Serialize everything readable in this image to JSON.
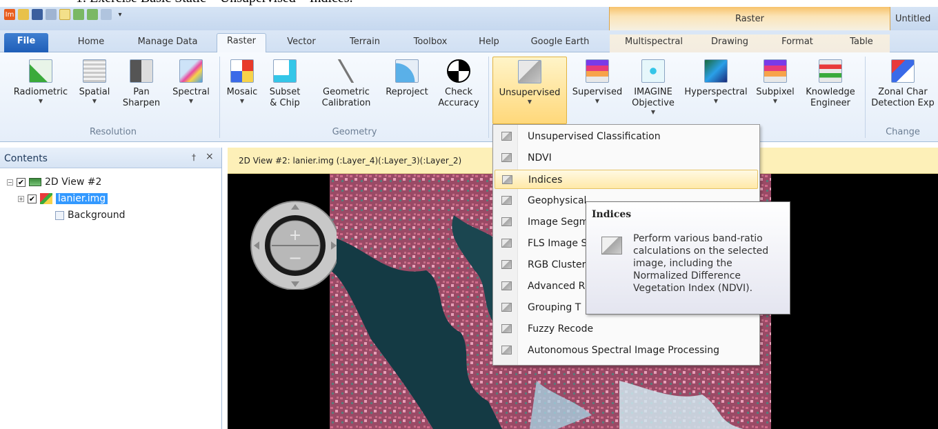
{
  "caption": "1. Exercise Basic Static – Unsupervised – Indices.",
  "app": {
    "title": "Untitled",
    "context_header": "Raster"
  },
  "tabs": [
    "File",
    "Home",
    "Manage Data",
    "Raster",
    "Vector",
    "Terrain",
    "Toolbox",
    "Help",
    "Google Earth",
    "Multispectral",
    "Drawing",
    "Format",
    "Table"
  ],
  "ribbon": {
    "resolution": {
      "label": "Resolution",
      "buttons": [
        "Radiometric",
        "Spatial",
        "Pan\nSharpen",
        "Spectral"
      ]
    },
    "geometry": {
      "label": "Geometry",
      "buttons": [
        "Mosaic",
        "Subset\n& Chip",
        "Geometric\nCalibration",
        "Reproject",
        "Check\nAccuracy"
      ]
    },
    "classification": {
      "buttons": [
        "Unsupervised",
        "Supervised",
        "IMAGINE\nObjective",
        "Hyperspectral",
        "Subpixel",
        "Knowledge\nEngineer"
      ]
    },
    "change": {
      "label": "Change",
      "buttons": [
        "Zonal Char\nDetection Exp"
      ]
    }
  },
  "contents": {
    "title": "Contents",
    "pin": "†",
    "close": "×",
    "tree": {
      "view": "2D View #2",
      "layer": "lanier.img",
      "background": "Background"
    }
  },
  "view": {
    "title": "2D View #2: lanier.img (:Layer_4)(:Layer_3)(:Layer_2)"
  },
  "menu": {
    "items": [
      "Unsupervised Classification",
      "NDVI",
      "Indices",
      "Geophysical",
      "Image Segm",
      "FLS Image S",
      "RGB Cluster",
      "Advanced R",
      "Grouping T",
      "Fuzzy Recode",
      "Autonomous Spectral Image Processing"
    ],
    "hover_index": 2
  },
  "tooltip": {
    "title": "Indices",
    "body": "Perform various band-ratio calculations on the selected image, including the Normalized Difference Vegetation Index (NDVI)."
  },
  "colors": {
    "accent": "#1f5eb8",
    "context": "#f7c36b",
    "hover": "#ffe9a8",
    "viewbar": "#fdf0b8"
  }
}
